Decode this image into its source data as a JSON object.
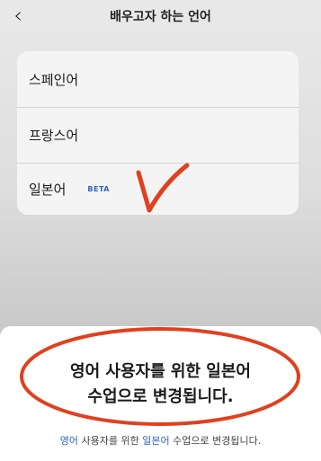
{
  "nav": {
    "back_icon": "chevron-left-icon",
    "back_glyph": "‹",
    "title": "배우고자 하는 언어"
  },
  "languages": [
    {
      "label": "스페인어"
    },
    {
      "label": "프랑스어"
    },
    {
      "label": "일본어",
      "badge": "BETA"
    }
  ],
  "sheet": {
    "line1": "영어 사용자를 위한 일본어",
    "line2": "수업으로 변경됩니다.",
    "footnote_part1": "영어",
    "footnote_part2": " 사용자를 위한 ",
    "footnote_part3": "일본어",
    "footnote_part4": " 수업으로 변경됩니다."
  },
  "colors": {
    "accent": "#2f63c9",
    "annotation": "#e0401e"
  }
}
